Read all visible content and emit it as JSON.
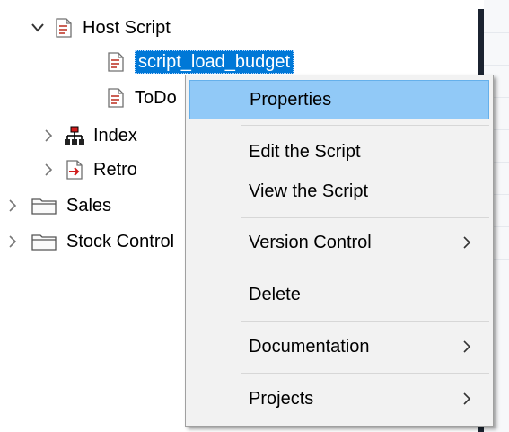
{
  "tree": {
    "items": [
      {
        "label": "Host Script",
        "expanded": true,
        "icon": "script-doc-icon"
      },
      {
        "label": "script_load_budget",
        "selected": true,
        "icon": "script-doc-icon"
      },
      {
        "label": "ToDo",
        "icon": "script-doc-icon"
      },
      {
        "label": "Index",
        "expanded": false,
        "icon": "index-hierarchy-icon"
      },
      {
        "label": "Retro",
        "expanded": false,
        "icon": "retro-arrow-icon"
      },
      {
        "label": "Sales",
        "expanded": false,
        "icon": "folder-icon"
      },
      {
        "label": "Stock Control",
        "expanded": false,
        "icon": "folder-icon"
      }
    ]
  },
  "context_menu": {
    "items": [
      {
        "label": "Properties",
        "hover": true
      },
      {
        "label": "Edit the Script"
      },
      {
        "label": "View the Script"
      },
      {
        "label": "Version Control",
        "submenu": true
      },
      {
        "label": "Delete"
      },
      {
        "label": "Documentation",
        "submenu": true
      },
      {
        "label": "Projects",
        "submenu": true
      }
    ]
  },
  "colors": {
    "selection": "#0078d7",
    "menu_hover": "#91c9f7",
    "menu_bg": "#f2f2f2",
    "doc_icon_red": "#c0392b",
    "divider": "#1b2330"
  }
}
